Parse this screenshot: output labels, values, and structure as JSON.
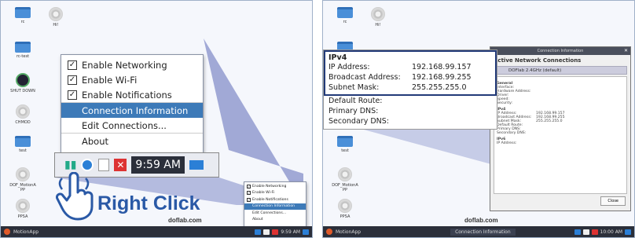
{
  "left": {
    "desktop_icons": [
      {
        "label": "rc",
        "icon": "folder-icon"
      },
      {
        "label": "Hi!",
        "icon": "gear-icon"
      },
      {
        "label": "rc-test",
        "icon": "folder-icon"
      },
      {
        "label": "SHUT DOWN",
        "icon": "power-icon"
      },
      {
        "label": "CHMOD",
        "icon": "gear-icon"
      },
      {
        "label": "test",
        "icon": "folder-icon"
      },
      {
        "label": "DOF_MotionA PP",
        "icon": "gear-icon"
      },
      {
        "label": "PPSA",
        "icon": "gear-icon"
      }
    ],
    "context_menu": {
      "items": [
        {
          "label": "Enable Networking",
          "checked": true
        },
        {
          "label": "Enable Wi-Fi",
          "checked": true
        },
        {
          "label": "Enable Notifications",
          "checked": true
        },
        {
          "label": "Connection Information",
          "active": true
        },
        {
          "label": "Edit Connections..."
        },
        {
          "label": "About"
        }
      ]
    },
    "tray_clock": "9:59 AM",
    "right_click_label": "Right Click",
    "site": "doflab.com",
    "taskbar": {
      "app": "MotionApp",
      "clock": "9:59 AM"
    },
    "mini_menu": [
      "Enable Networking",
      "Enable Wi-Fi",
      "Enable Notifications",
      "Connection Information",
      "Edit Connections...",
      "About"
    ]
  },
  "right": {
    "desktop_icons": [
      {
        "label": "rc",
        "icon": "folder-icon"
      },
      {
        "label": "Hi!",
        "icon": "gear-icon"
      },
      {
        "label": "rc-test",
        "icon": "folder-icon"
      },
      {
        "label": "test",
        "icon": "folder-icon"
      },
      {
        "label": "DOF_MotionA PP",
        "icon": "gear-icon"
      },
      {
        "label": "PPSA",
        "icon": "gear-icon"
      }
    ],
    "window": {
      "title": "Connection Information",
      "heading": "Active Network Connections",
      "tab": "DOFlab 2.4GHz (default)",
      "general": {
        "title": "General",
        "rows": [
          "Interface:",
          "Hardware Address:",
          "Driver:",
          "Speed:",
          "Security:"
        ]
      },
      "ipv4": {
        "title": "IPv4",
        "rows": [
          {
            "k": "IP Address:",
            "v": "192.168.99.157"
          },
          {
            "k": "Broadcast Address:",
            "v": "192.168.99.255"
          },
          {
            "k": "Subnet Mask:",
            "v": "255.255.255.0"
          },
          {
            "k": "Default Route:",
            "v": ""
          },
          {
            "k": "Primary DNS:",
            "v": ""
          },
          {
            "k": "Secondary DNS:",
            "v": ""
          }
        ]
      },
      "ipv6": {
        "title": "IPv6",
        "rows": [
          "IP Address:"
        ]
      },
      "close": "Close"
    },
    "zoom": {
      "title": "IPv4",
      "highlighted": [
        {
          "k": "IP Address:",
          "v": "192.168.99.157"
        },
        {
          "k": "Broadcast Address:",
          "v": "192.168.99.255"
        },
        {
          "k": "Subnet Mask:",
          "v": "255.255.255.0"
        }
      ],
      "rest": [
        "Default Route:",
        "Primary DNS:",
        "Secondary DNS:"
      ]
    },
    "site": "doflab.com",
    "taskbar": {
      "app": "MotionApp",
      "task": "Connection Information",
      "clock": "10:00 AM"
    }
  },
  "colors": {
    "accent": "#3d7ab8",
    "highlight_border": "#223a78",
    "wedge": "#3b4aa8"
  }
}
